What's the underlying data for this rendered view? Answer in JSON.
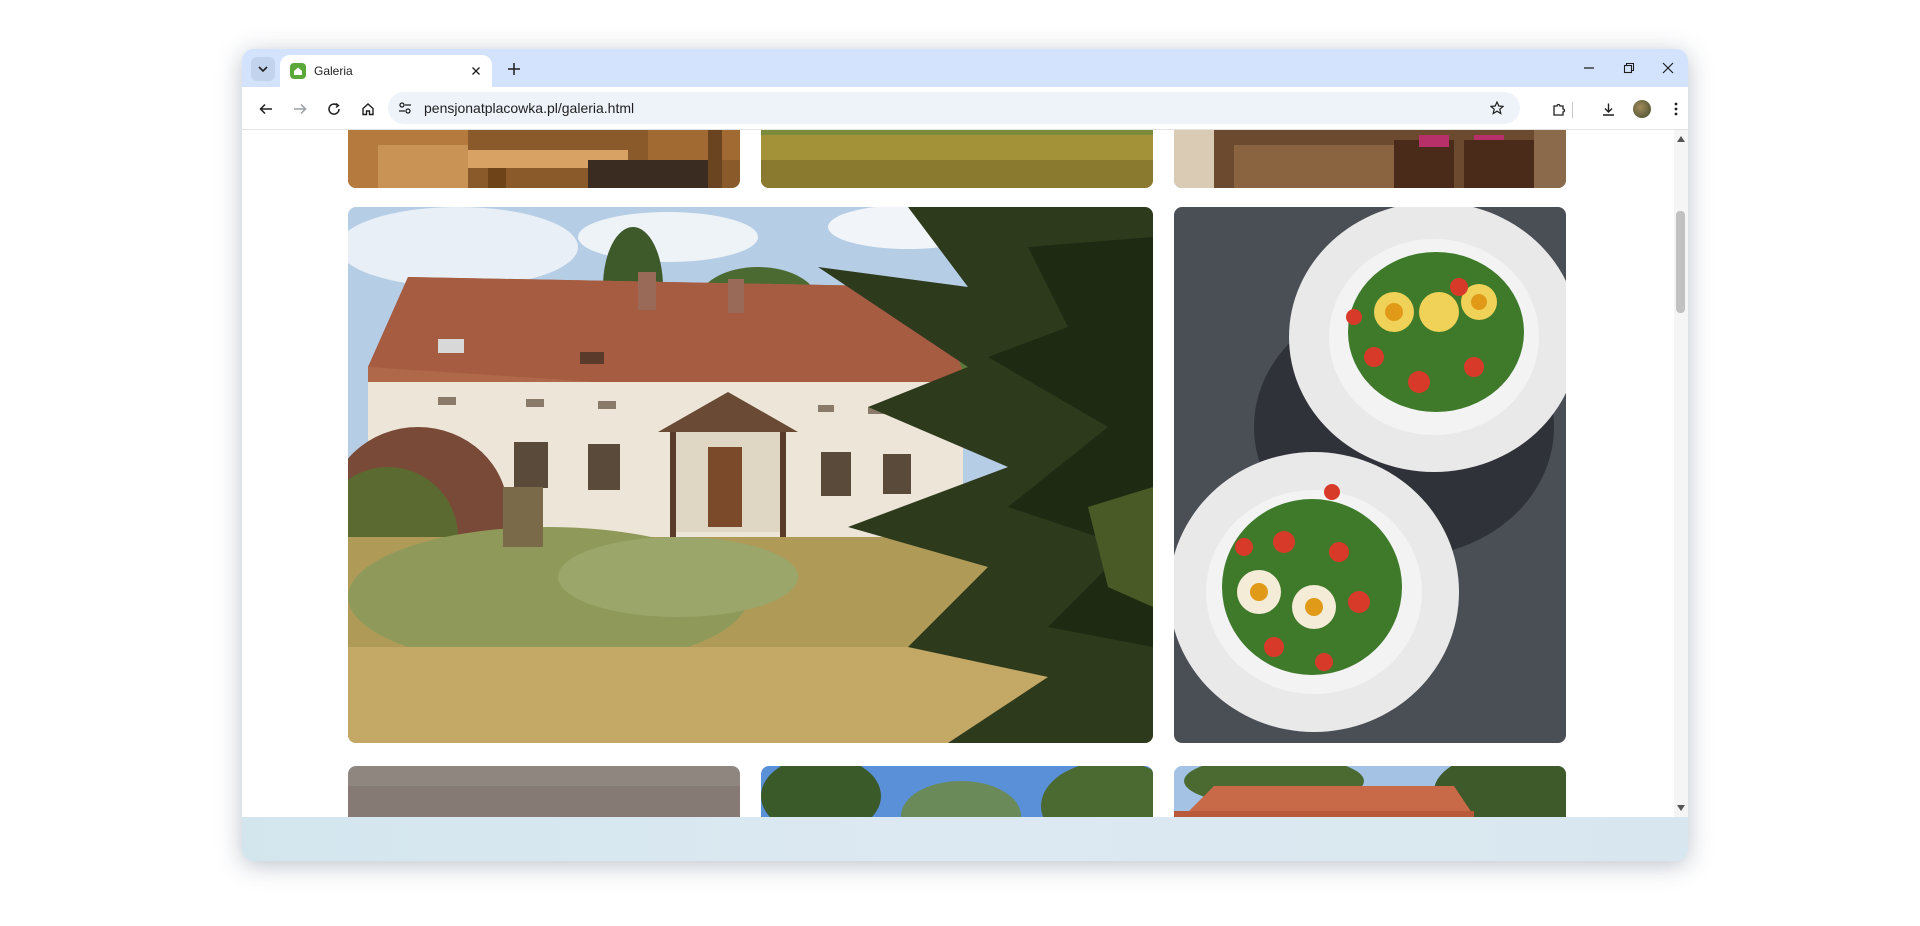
{
  "browser": {
    "tab": {
      "title": "Galeria",
      "favicon": "green-house-favicon"
    },
    "address": {
      "url": "pensjonatplacowka.pl/galeria.html"
    }
  },
  "gallery": {
    "photos": [
      {
        "name": "photo-wooden-table",
        "description_icon": "image"
      },
      {
        "name": "photo-meadow",
        "description_icon": "image"
      },
      {
        "name": "photo-dining-room",
        "description_icon": "image"
      },
      {
        "name": "photo-guesthouse",
        "description_icon": "image"
      },
      {
        "name": "photo-salad-plates",
        "description_icon": "image"
      },
      {
        "name": "photo-gray-wall",
        "description_icon": "image"
      },
      {
        "name": "photo-trees-sky",
        "description_icon": "image"
      },
      {
        "name": "photo-roof",
        "description_icon": "image"
      }
    ]
  },
  "colors": {
    "tabbar": "#d3e3fd",
    "omnibox": "#eef2f9",
    "favicon": "#5aa83a"
  }
}
